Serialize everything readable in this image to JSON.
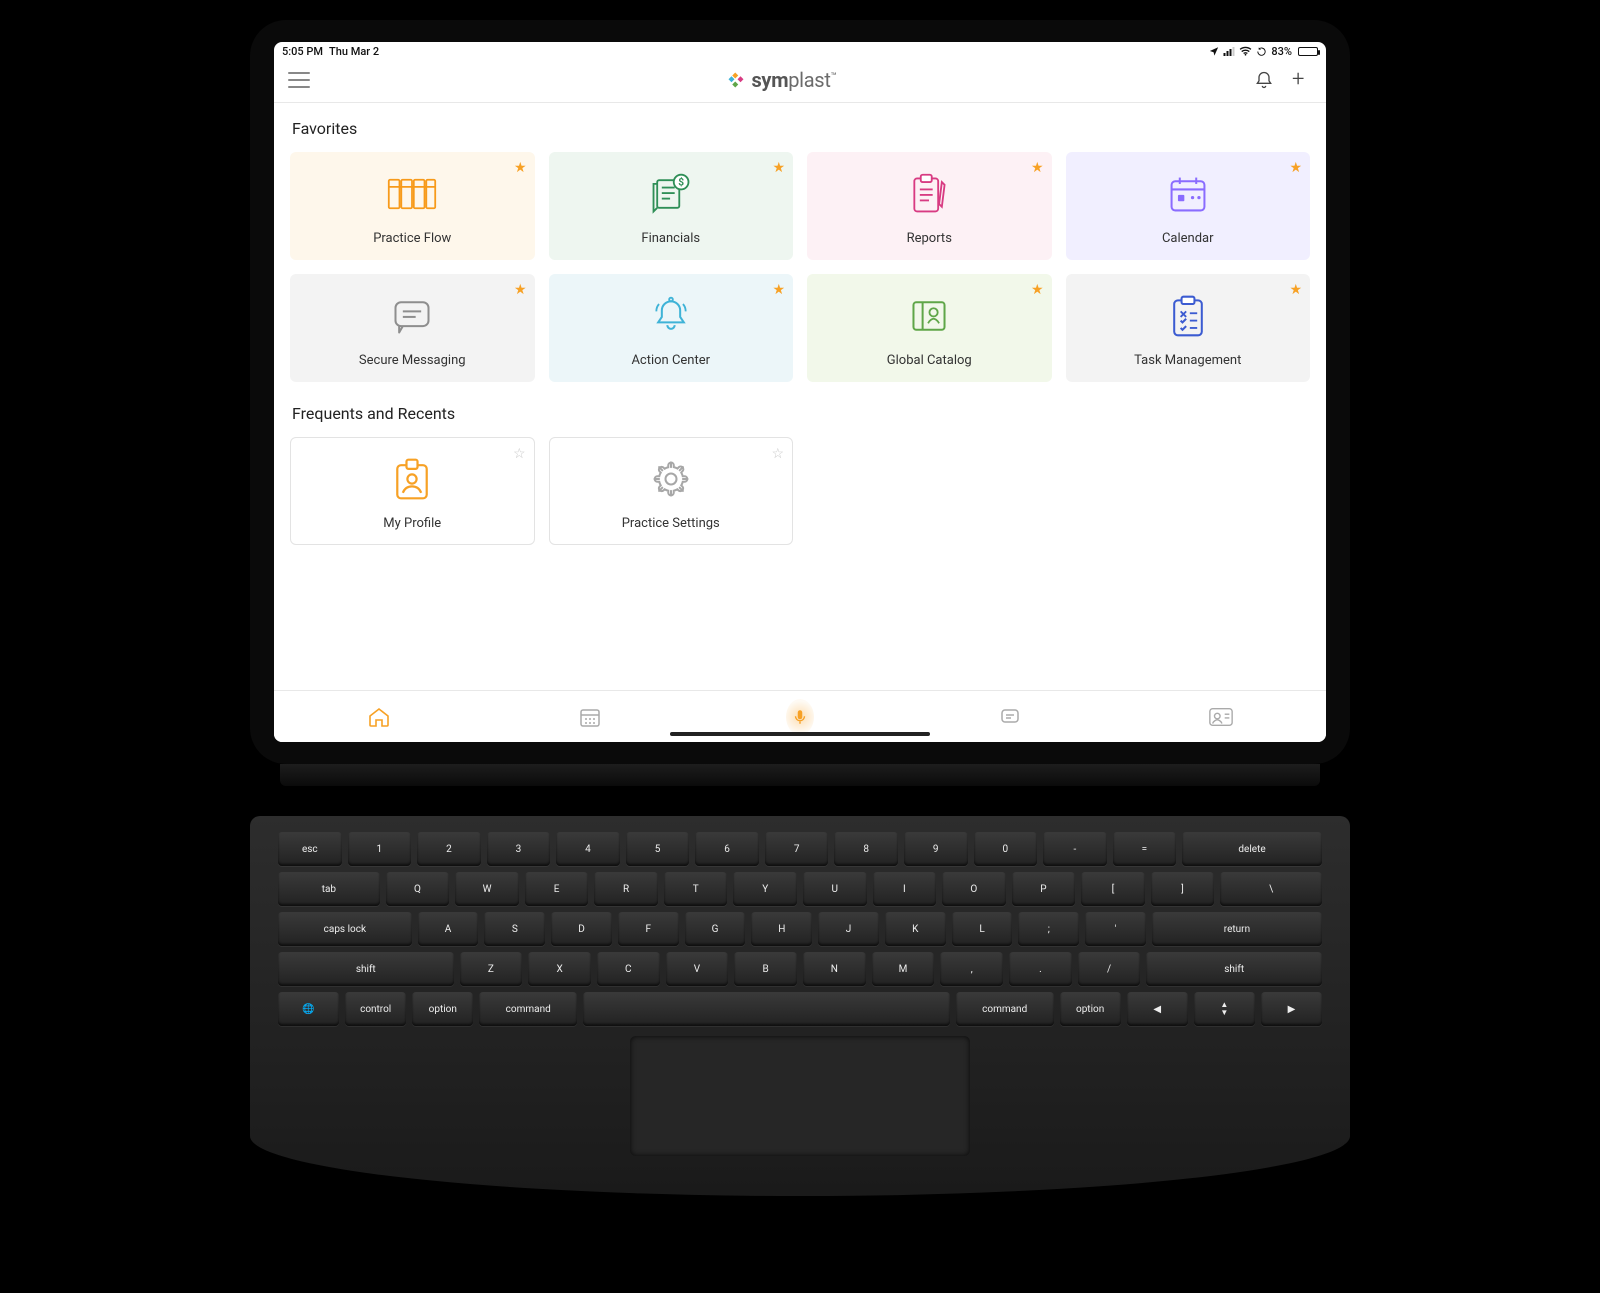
{
  "status": {
    "time": "5:05 PM",
    "date": "Thu Mar 2",
    "battery_pct": "83%",
    "battery_level": 83
  },
  "brand": {
    "name_bold": "sym",
    "name_light": "plast"
  },
  "sections": {
    "favorites_title": "Favorites",
    "recents_title": "Frequents and Recents"
  },
  "favorites": [
    {
      "id": "practice-flow",
      "label": "Practice Flow",
      "icon": "columns",
      "bg": "#fef7eb",
      "fg": "#f79a1a"
    },
    {
      "id": "financials",
      "label": "Financials",
      "icon": "invoice",
      "bg": "#eef6f0",
      "fg": "#2f8f57"
    },
    {
      "id": "reports",
      "label": "Reports",
      "icon": "clipboard",
      "bg": "#fdf1f5",
      "fg": "#d83b82"
    },
    {
      "id": "calendar",
      "label": "Calendar",
      "icon": "calendar",
      "bg": "#f1efff",
      "fg": "#8a6cff"
    },
    {
      "id": "secure-msg",
      "label": "Secure Messaging",
      "icon": "chat",
      "bg": "#f3f3f3",
      "fg": "#8e8e8e"
    },
    {
      "id": "action-center",
      "label": "Action Center",
      "icon": "bell",
      "bg": "#ecf6f9",
      "fg": "#3fb3d7"
    },
    {
      "id": "global-catalog",
      "label": "Global Catalog",
      "icon": "book",
      "bg": "#f2f8ea",
      "fg": "#5fa648"
    },
    {
      "id": "task-mgmt",
      "label": "Task Management",
      "icon": "checklist",
      "bg": "#f3f3f3",
      "fg": "#3b5bd1"
    }
  ],
  "recents": [
    {
      "id": "my-profile",
      "label": "My Profile",
      "icon": "badge",
      "fg": "#f7a125"
    },
    {
      "id": "practice-settings",
      "label": "Practice Settings",
      "icon": "gear",
      "fg": "#a7a7a7"
    }
  ]
}
